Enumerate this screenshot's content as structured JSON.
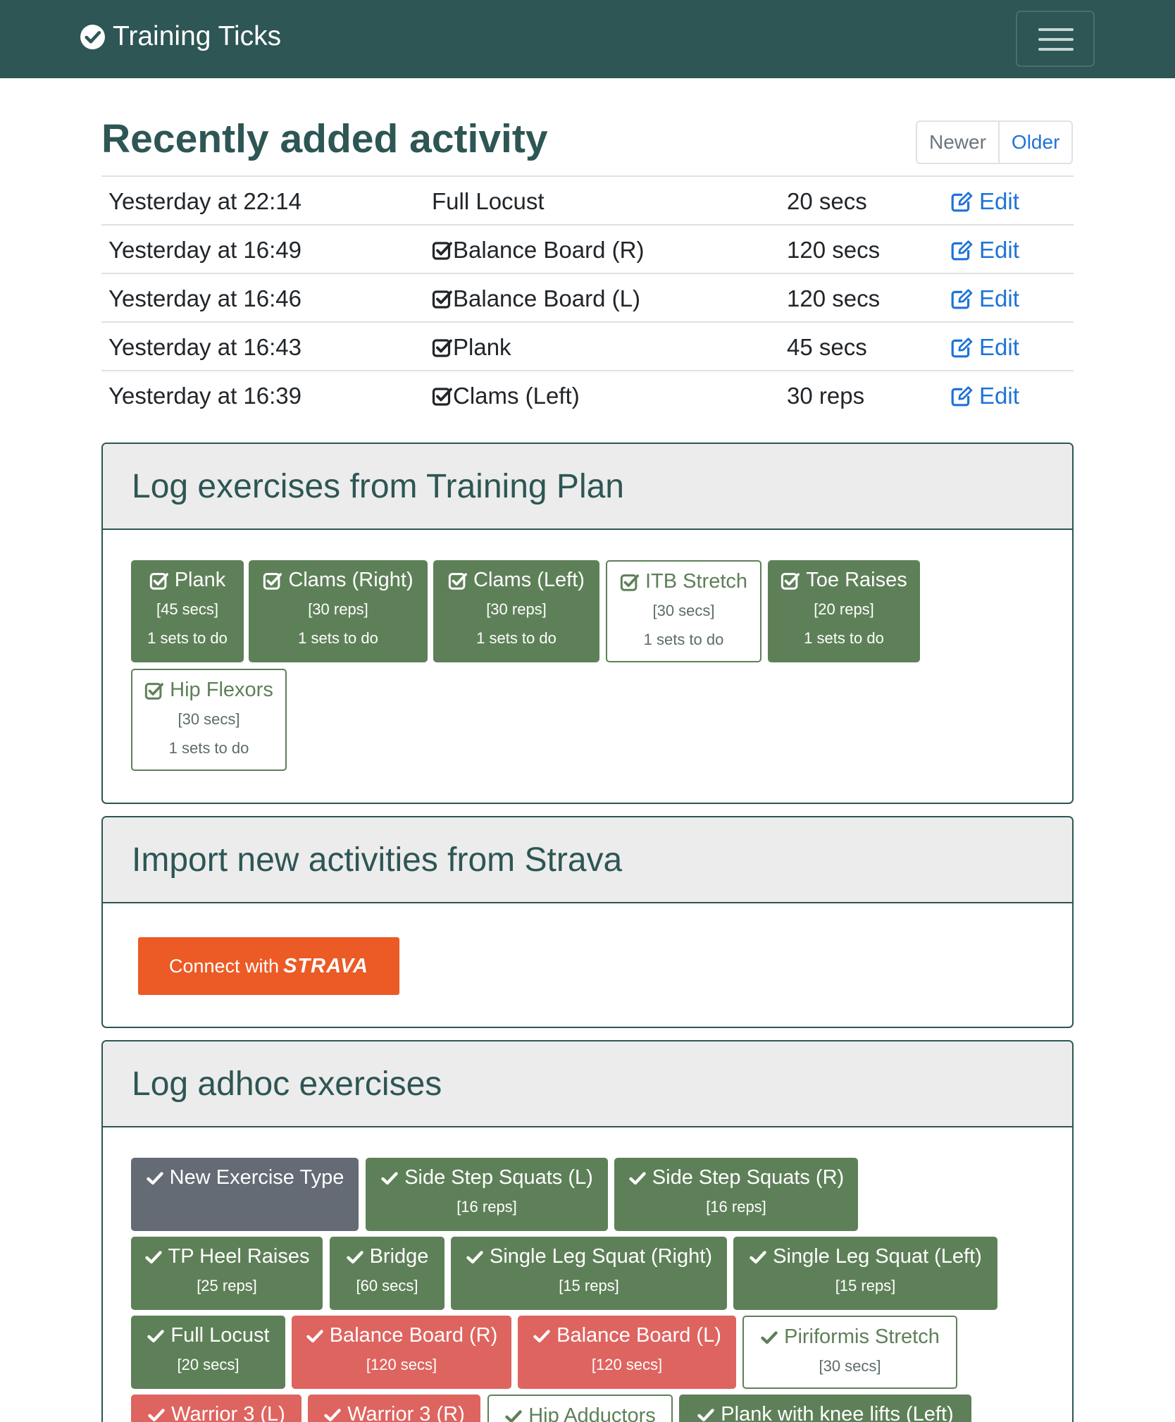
{
  "navbar": {
    "brand": "Training Ticks",
    "brand_icon": "check-circle-icon",
    "menu_icon": "hamburger-menu-icon"
  },
  "recent": {
    "title": "Recently added activity",
    "newer_label": "Newer",
    "older_label": "Older",
    "rows": [
      {
        "time": "Yesterday at 22:14",
        "name": "Full Locust",
        "checked": false,
        "amount": "20 secs",
        "edit": "Edit"
      },
      {
        "time": "Yesterday at 16:49",
        "name": "Balance Board (R)",
        "checked": true,
        "amount": "120 secs",
        "edit": "Edit"
      },
      {
        "time": "Yesterday at 16:46",
        "name": "Balance Board (L)",
        "checked": true,
        "amount": "120 secs",
        "edit": "Edit"
      },
      {
        "time": "Yesterday at 16:43",
        "name": "Plank",
        "checked": true,
        "amount": "45 secs",
        "edit": "Edit"
      },
      {
        "time": "Yesterday at 16:39",
        "name": "Clams (Left)",
        "checked": true,
        "amount": "30 reps",
        "edit": "Edit"
      }
    ]
  },
  "plan": {
    "title": "Log exercises from Training Plan",
    "items": [
      {
        "name": "Plank",
        "detail": "[45 secs]",
        "sets": "1 sets to do",
        "style": "solid"
      },
      {
        "name": "Clams (Right)",
        "detail": "[30 reps]",
        "sets": "1 sets to do",
        "style": "solid"
      },
      {
        "name": "Clams (Left)",
        "detail": "[30 reps]",
        "sets": "1 sets to do",
        "style": "solid"
      },
      {
        "name": "ITB Stretch",
        "detail": "[30 secs]",
        "sets": "1 sets to do",
        "style": "outline"
      },
      {
        "name": "Toe Raises",
        "detail": "[20 reps]",
        "sets": "1 sets to do",
        "style": "solid"
      },
      {
        "name": "Hip Flexors",
        "detail": "[30 secs]",
        "sets": "1 sets to do",
        "style": "outline"
      }
    ]
  },
  "strava": {
    "title": "Import new activities from Strava",
    "button_prefix": "Connect with",
    "button_brand": "STRAVA"
  },
  "adhoc": {
    "title": "Log adhoc exercises",
    "items": [
      {
        "name": "New Exercise Type",
        "detail": "",
        "style": "grey"
      },
      {
        "name": "Side Step Squats (L)",
        "detail": "[16 reps]",
        "style": "green"
      },
      {
        "name": "Side Step Squats (R)",
        "detail": "[16 reps]",
        "style": "green"
      },
      {
        "name": "TP Heel Raises",
        "detail": "[25 reps]",
        "style": "green"
      },
      {
        "name": "Bridge",
        "detail": "[60 secs]",
        "style": "green"
      },
      {
        "name": "Single Leg Squat (Right)",
        "detail": "[15 reps]",
        "style": "green"
      },
      {
        "name": "Single Leg Squat (Left)",
        "detail": "[15 reps]",
        "style": "green"
      },
      {
        "name": "Full Locust",
        "detail": "[20 secs]",
        "style": "green"
      },
      {
        "name": "Balance Board (R)",
        "detail": "[120 secs]",
        "style": "red"
      },
      {
        "name": "Balance Board (L)",
        "detail": "[120 secs]",
        "style": "red"
      },
      {
        "name": "Piriformis Stretch",
        "detail": "[30 secs]",
        "style": "outline"
      },
      {
        "name": "Warrior 3 (L)",
        "detail": "",
        "style": "red"
      },
      {
        "name": "Warrior 3 (R)",
        "detail": "",
        "style": "red"
      },
      {
        "name": "Hip Adductors",
        "detail": "",
        "style": "outline"
      },
      {
        "name": "Plank with knee lifts (Left)",
        "detail": "",
        "style": "green"
      }
    ]
  },
  "colors": {
    "navbar": "#2d5654",
    "green": "#5e8058",
    "red": "#de6460",
    "grey": "#646b75",
    "link": "#1e73d8",
    "strava": "#ec5a25"
  }
}
